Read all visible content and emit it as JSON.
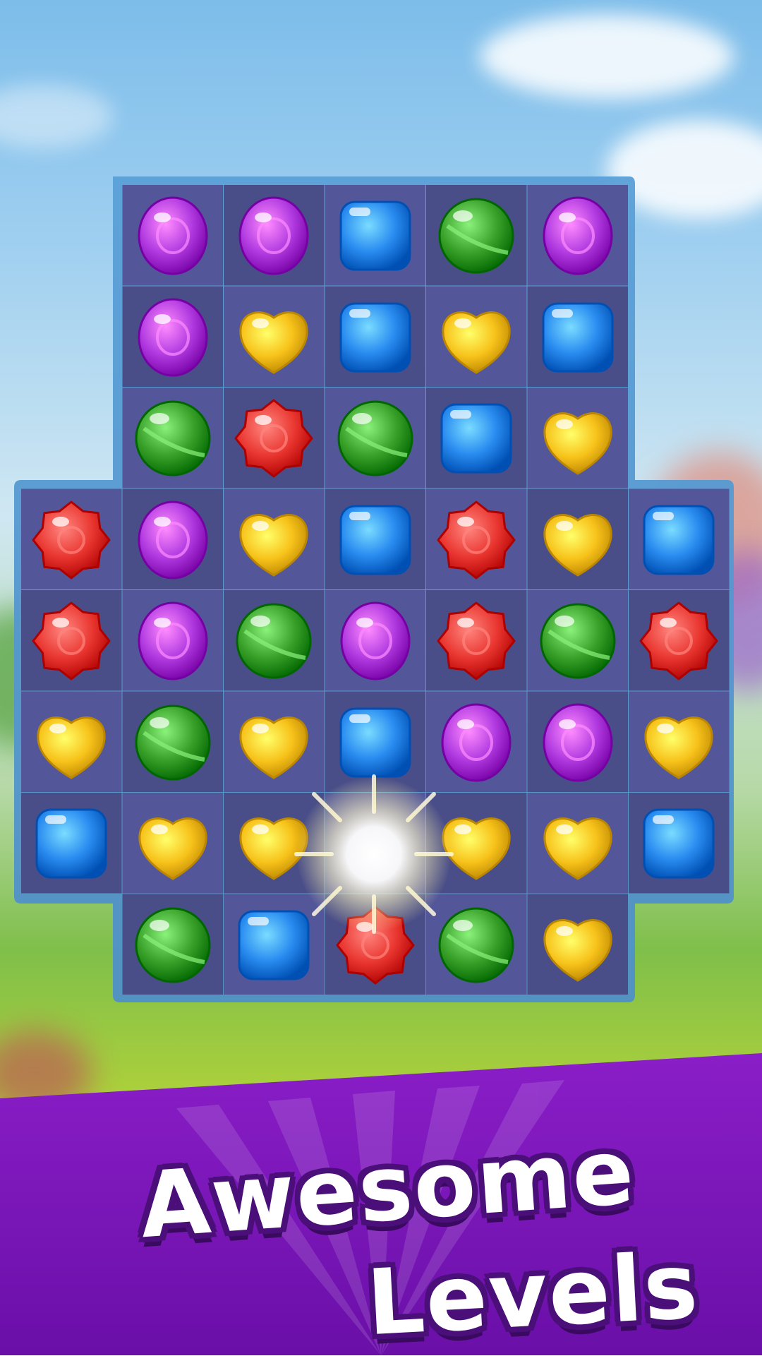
{
  "title": {
    "line1": "Awesome",
    "line2": "Levels"
  },
  "colors": {
    "purple": "#b13be0",
    "yellow": "#f7c21a",
    "blue": "#2a8cf0",
    "green": "#3aa22a",
    "red": "#e9352f",
    "board": "#4b4f8c",
    "banner": "#7a16b8"
  },
  "board": {
    "cols": 7,
    "rows": 8,
    "grid": [
      [
        "",
        "purple",
        "purple",
        "blue",
        "green",
        "purple",
        ""
      ],
      [
        "",
        "purple",
        "yellow",
        "blue",
        "yellow",
        "blue",
        ""
      ],
      [
        "",
        "green",
        "red",
        "green",
        "blue",
        "yellow",
        ""
      ],
      [
        "red",
        "purple",
        "yellow",
        "blue",
        "red",
        "yellow",
        "blue"
      ],
      [
        "red",
        "purple",
        "green",
        "purple",
        "red",
        "green",
        "red"
      ],
      [
        "yellow",
        "green",
        "yellow",
        "blue",
        "purple",
        "purple",
        "yellow"
      ],
      [
        "blue",
        "yellow",
        "yellow",
        "sparkle",
        "yellow",
        "yellow",
        "blue"
      ],
      [
        "",
        "green",
        "blue",
        "red",
        "green",
        "yellow",
        ""
      ]
    ]
  }
}
